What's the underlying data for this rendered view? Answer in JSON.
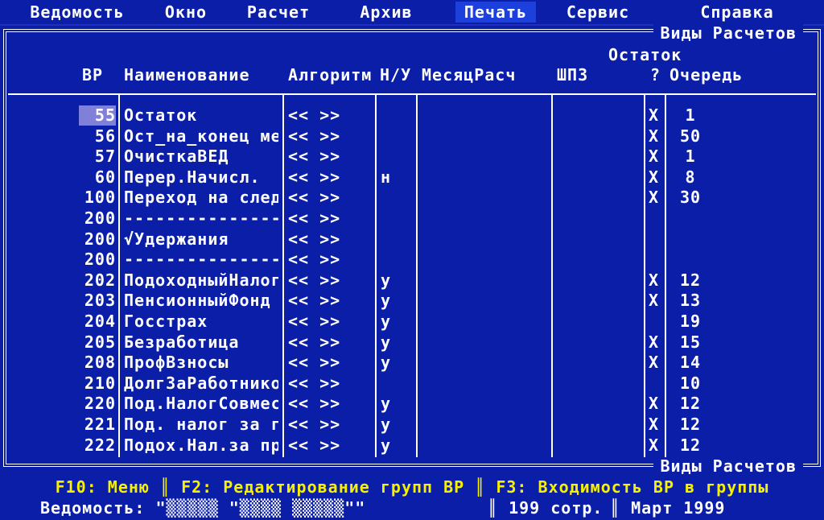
{
  "menu": [
    {
      "label": "Ведомость"
    },
    {
      "label": "Окно"
    },
    {
      "label": "Расчет"
    },
    {
      "label": "Архив"
    },
    {
      "label": "Печать"
    },
    {
      "label": "Сервис"
    },
    {
      "label": "Справка"
    }
  ],
  "window": {
    "title": "Виды Расчетов"
  },
  "columns": {
    "vr": "ВР",
    "name": "Наименование",
    "algorithm": "Алгоритм",
    "nu": "Н/У",
    "month": "МесяцРасч",
    "shpz": "ШПЗ",
    "remainder_top": "Остаток",
    "remainder_q": "?",
    "queue": "Очередь"
  },
  "rows": [
    {
      "vr": "55",
      "name": "Остаток",
      "alg": "<< >>",
      "nu": "",
      "ost": "X",
      "q": "1"
    },
    {
      "vr": "56",
      "name": "Ост_на_конец ме",
      "alg": "<< >>",
      "nu": "",
      "ost": "X",
      "q": "50"
    },
    {
      "vr": "57",
      "name": "ОчисткаВЕД",
      "alg": "<< >>",
      "nu": "",
      "ost": "X",
      "q": "1"
    },
    {
      "vr": "60",
      "name": "Перер.Начисл.",
      "alg": "<< >>",
      "nu": "н",
      "ost": "X",
      "q": "8"
    },
    {
      "vr": "100",
      "name": "Переход на след",
      "alg": "<< >>",
      "nu": "",
      "ost": "X",
      "q": "30"
    },
    {
      "vr": "200",
      "name": "---------------",
      "alg": "<< >>",
      "nu": "",
      "ost": "",
      "q": ""
    },
    {
      "vr": "200",
      "name": "√Удержания",
      "alg": "<< >>",
      "nu": "",
      "ost": "",
      "q": ""
    },
    {
      "vr": "200",
      "name": "---------------",
      "alg": "<< >>",
      "nu": "",
      "ost": "",
      "q": ""
    },
    {
      "vr": "202",
      "name": "ПодоходныйНалог",
      "alg": "<< >>",
      "nu": "у",
      "ost": "X",
      "q": "12"
    },
    {
      "vr": "203",
      "name": "ПенсионныйФонд",
      "alg": "<< >>",
      "nu": "у",
      "ost": "X",
      "q": "13"
    },
    {
      "vr": "204",
      "name": "Госстрах",
      "alg": "<< >>",
      "nu": "у",
      "ost": "",
      "q": "19"
    },
    {
      "vr": "205",
      "name": "Безработица",
      "alg": "<< >>",
      "nu": "у",
      "ost": "X",
      "q": "15"
    },
    {
      "vr": "208",
      "name": "ПрофВзносы",
      "alg": "<< >>",
      "nu": "у",
      "ost": "X",
      "q": "14"
    },
    {
      "vr": "210",
      "name": "ДолгЗаРаботнико",
      "alg": "<< >>",
      "nu": "",
      "ost": "",
      "q": "10"
    },
    {
      "vr": "220",
      "name": "Под.НалогСовмес",
      "alg": "<< >>",
      "nu": "у",
      "ost": "X",
      "q": "12"
    },
    {
      "vr": "221",
      "name": "Под. налог за г",
      "alg": "<< >>",
      "nu": "у",
      "ost": "X",
      "q": "12"
    },
    {
      "vr": "222",
      "name": "Подох.Нал.за пр",
      "alg": "<< >>",
      "nu": "у",
      "ost": "X",
      "q": "12"
    }
  ],
  "hotkeys": "F10: Меню ║ F2: Редактирование групп ВР ║ F3: Входимость ВР в группы",
  "info": {
    "statement": "Ведомость: \"▒▒▒▒▒ \"▒▒▒▒ ▒▒▒▒▒\"\"",
    "employees": "║ 199 сотр.",
    "period": "║ Март 1999"
  },
  "colors": {
    "background": "#0a1ea8",
    "menu_active": "#1d3fdc",
    "selection": "#8080d8",
    "hotkey_text": "#f7f000"
  }
}
